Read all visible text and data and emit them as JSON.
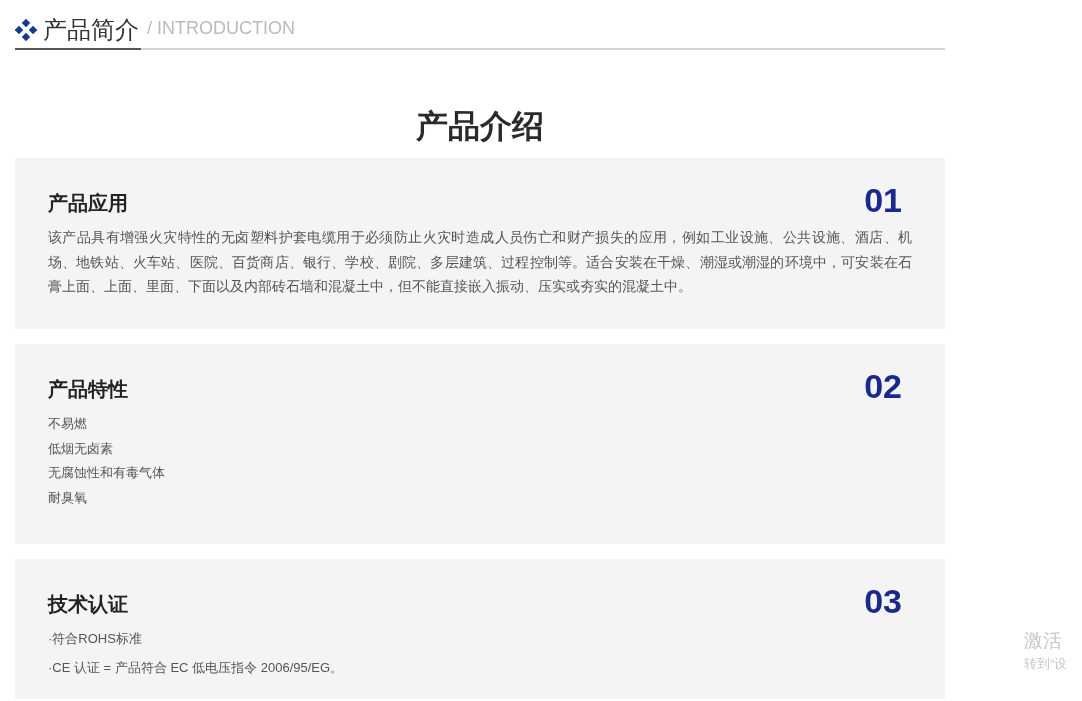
{
  "section_header": {
    "title": "产品简介",
    "subtitle": "/ INTRODUCTION"
  },
  "page_title": "产品介绍",
  "cards": [
    {
      "title": "产品应用",
      "number": "01",
      "kind": "paragraph",
      "lines": [
        "该产品具有增强火灾特性的无卤塑料护套电缆用于必须防止火灾时造成人员伤亡和财产损失的应用，例如工业设施、公共设施、酒店、机场、地铁站、火车站、医院、百货商店、银行、学校、剧院、多层建筑、过程控制等。适合安装在干燥、潮湿或潮湿的环境中，可安装在石膏上面、上面、里面、下面以及内部砖石墙和混凝土中，但不能直接嵌入振动、压实或夯实的混凝土中。"
      ]
    },
    {
      "title": "产品特性",
      "number": "02",
      "kind": "list",
      "lines": [
        "不易燃",
        "低烟无卤素",
        "无腐蚀性和有毒气体",
        "耐臭氧"
      ]
    },
    {
      "title": "技术认证",
      "number": "03",
      "kind": "spaced-list",
      "lines": [
        "·符合ROHS标准",
        "·CE 认证 = 产品符合 EC 低电压指令 2006/95/EG。"
      ]
    }
  ],
  "os_overlay": {
    "line_1": "激活",
    "line_2": "转到“设"
  }
}
